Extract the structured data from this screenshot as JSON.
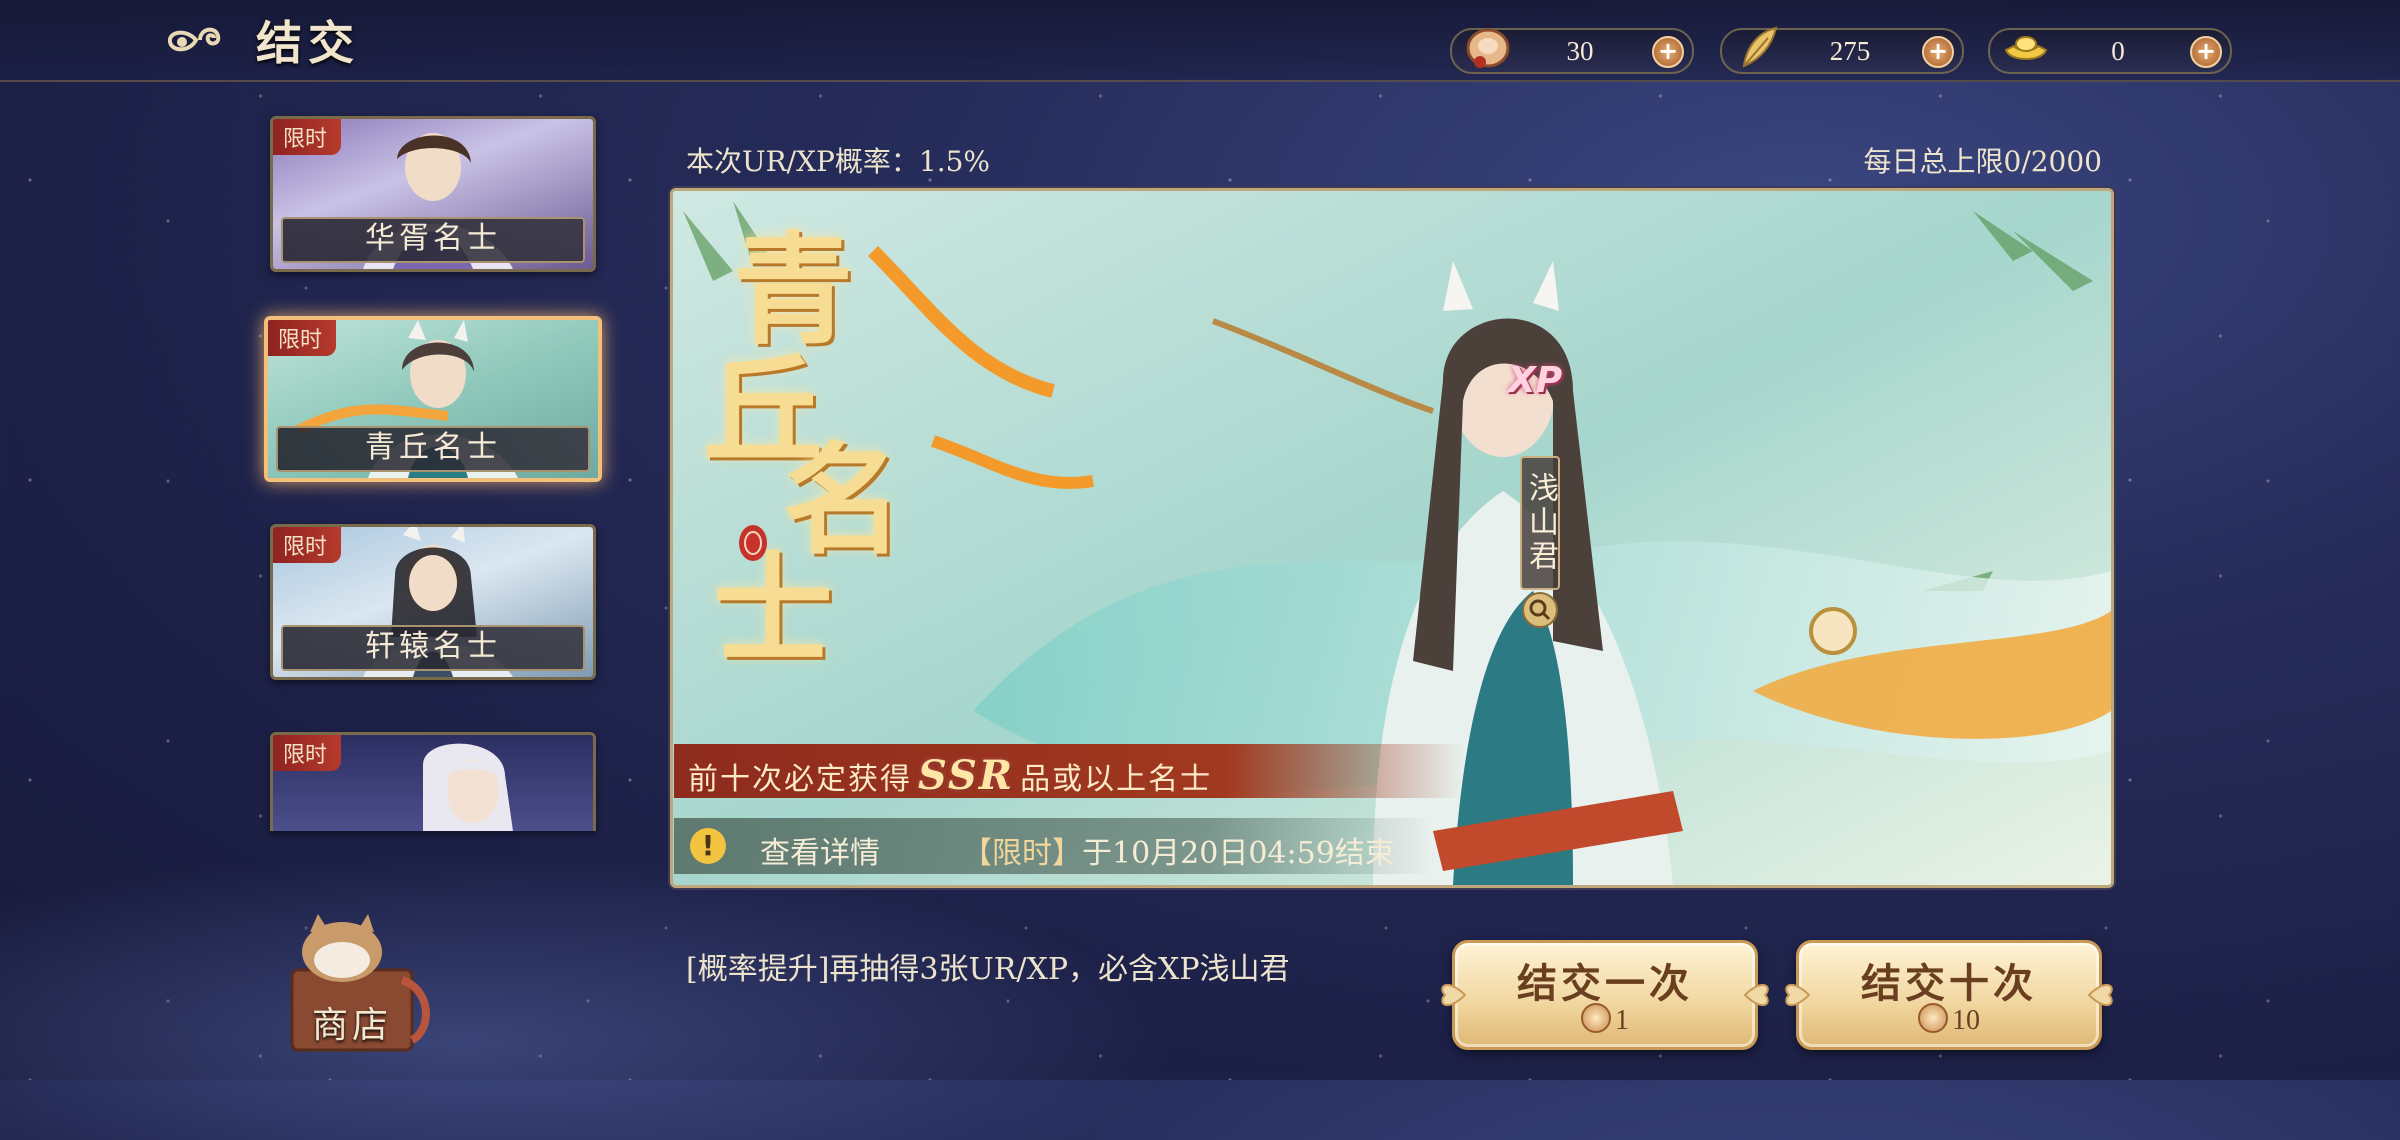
{
  "header": {
    "title": "结交",
    "currencies": [
      {
        "icon": "pouch-coin-icon",
        "value": "30"
      },
      {
        "icon": "feather-icon",
        "value": "275"
      },
      {
        "icon": "gold-ingot-icon",
        "value": "0"
      }
    ]
  },
  "banners": [
    {
      "tag": "限时",
      "name": "华胥名士",
      "active": false
    },
    {
      "tag": "限时",
      "name": "青丘名士",
      "active": true
    },
    {
      "tag": "限时",
      "name": "轩辕名士",
      "active": false
    },
    {
      "tag": "限时",
      "name": "",
      "active": false
    }
  ],
  "pool": {
    "rate_text": "本次UR/XP概率：1.5%",
    "daily_limit": "每日总上限0/2000",
    "title_chars": [
      "青",
      "丘",
      "名",
      "士"
    ],
    "character_badge": "XP",
    "character_name": "浅山君",
    "guarantee_prefix": "前十次必定获得",
    "guarantee_rarity": "SSR",
    "guarantee_suffix": "品或以上名士",
    "details_label": "查看详情",
    "time_tag": "【限时】",
    "end_time": "于10月20日04:59结束"
  },
  "boost_text": "[概率提升]再抽得3张UR/XP，必含XP浅山君",
  "shop_label": "商店",
  "buttons": {
    "single_label": "结交一次",
    "single_cost": "1",
    "ten_label": "结交十次",
    "ten_cost": "10"
  },
  "colors": {
    "accent_gold": "#f1c07a",
    "tag_red": "#b63a2c",
    "button_text": "#6a3f20"
  }
}
